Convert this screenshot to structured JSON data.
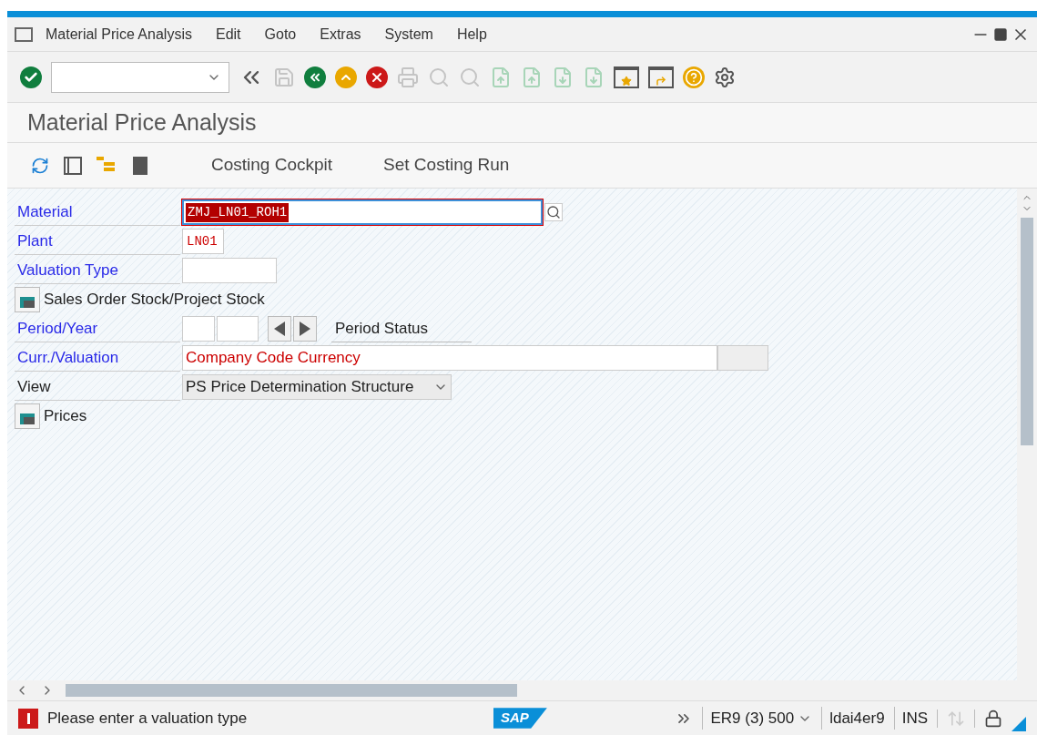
{
  "menu": [
    {
      "label": "Material Price Analysis"
    },
    {
      "label": "Edit"
    },
    {
      "label": "Goto"
    },
    {
      "label": "Extras"
    },
    {
      "label": "System"
    },
    {
      "label": "Help"
    }
  ],
  "toolbar": [
    {
      "kind": "back",
      "disabled": false
    },
    {
      "kind": "save",
      "disabled": true
    },
    {
      "kind": "green-back",
      "disabled": false
    },
    {
      "kind": "exit",
      "disabled": false
    },
    {
      "kind": "cancel",
      "disabled": false
    },
    {
      "kind": "print",
      "disabled": true
    },
    {
      "kind": "find",
      "disabled": true
    },
    {
      "kind": "find-next",
      "disabled": true
    },
    {
      "kind": "first-page",
      "disabled": true
    },
    {
      "kind": "prev-page",
      "disabled": true
    },
    {
      "kind": "next-page",
      "disabled": true
    },
    {
      "kind": "last-page",
      "disabled": true
    },
    {
      "kind": "new-session",
      "disabled": false
    },
    {
      "kind": "shortcut",
      "disabled": false
    },
    {
      "kind": "help",
      "disabled": false
    },
    {
      "kind": "settings",
      "disabled": false
    }
  ],
  "title": "Material Price Analysis",
  "app_toolbar": {
    "icons": [
      {
        "kind": "refresh"
      },
      {
        "kind": "layout"
      },
      {
        "kind": "tree"
      },
      {
        "kind": "exit-door"
      }
    ],
    "buttons": [
      "Costing Cockpit",
      "Set Costing Run"
    ]
  },
  "form": [
    {
      "kind": "search_field",
      "label": "Material",
      "required": true,
      "value": "ZMJ_LN01_ROH1",
      "selected": true
    },
    {
      "kind": "field",
      "label": "Plant",
      "required": true,
      "value": "LN01",
      "highlighted": true
    },
    {
      "kind": "field",
      "label": "Valuation Type",
      "required": true
    },
    {
      "kind": "section",
      "label": "Sales Order Stock/Project Stock"
    },
    {
      "kind": "period",
      "label": "Period/Year",
      "required": true,
      "status_label": "Period Status"
    },
    {
      "kind": "currency",
      "label": "Curr./Valuation",
      "required": true,
      "value": "Company Code Currency",
      "highlighted": true
    },
    {
      "kind": "dropdown",
      "label": "View",
      "required": false,
      "value": "PS Price Determination Structure"
    },
    {
      "kind": "section",
      "label": "Prices"
    }
  ],
  "status_bar": {
    "message": "Please enter a valuation type",
    "logo_text": "SAP",
    "system": "ER9 (3) 500",
    "server": "ldai4er9",
    "mode": "INS"
  }
}
